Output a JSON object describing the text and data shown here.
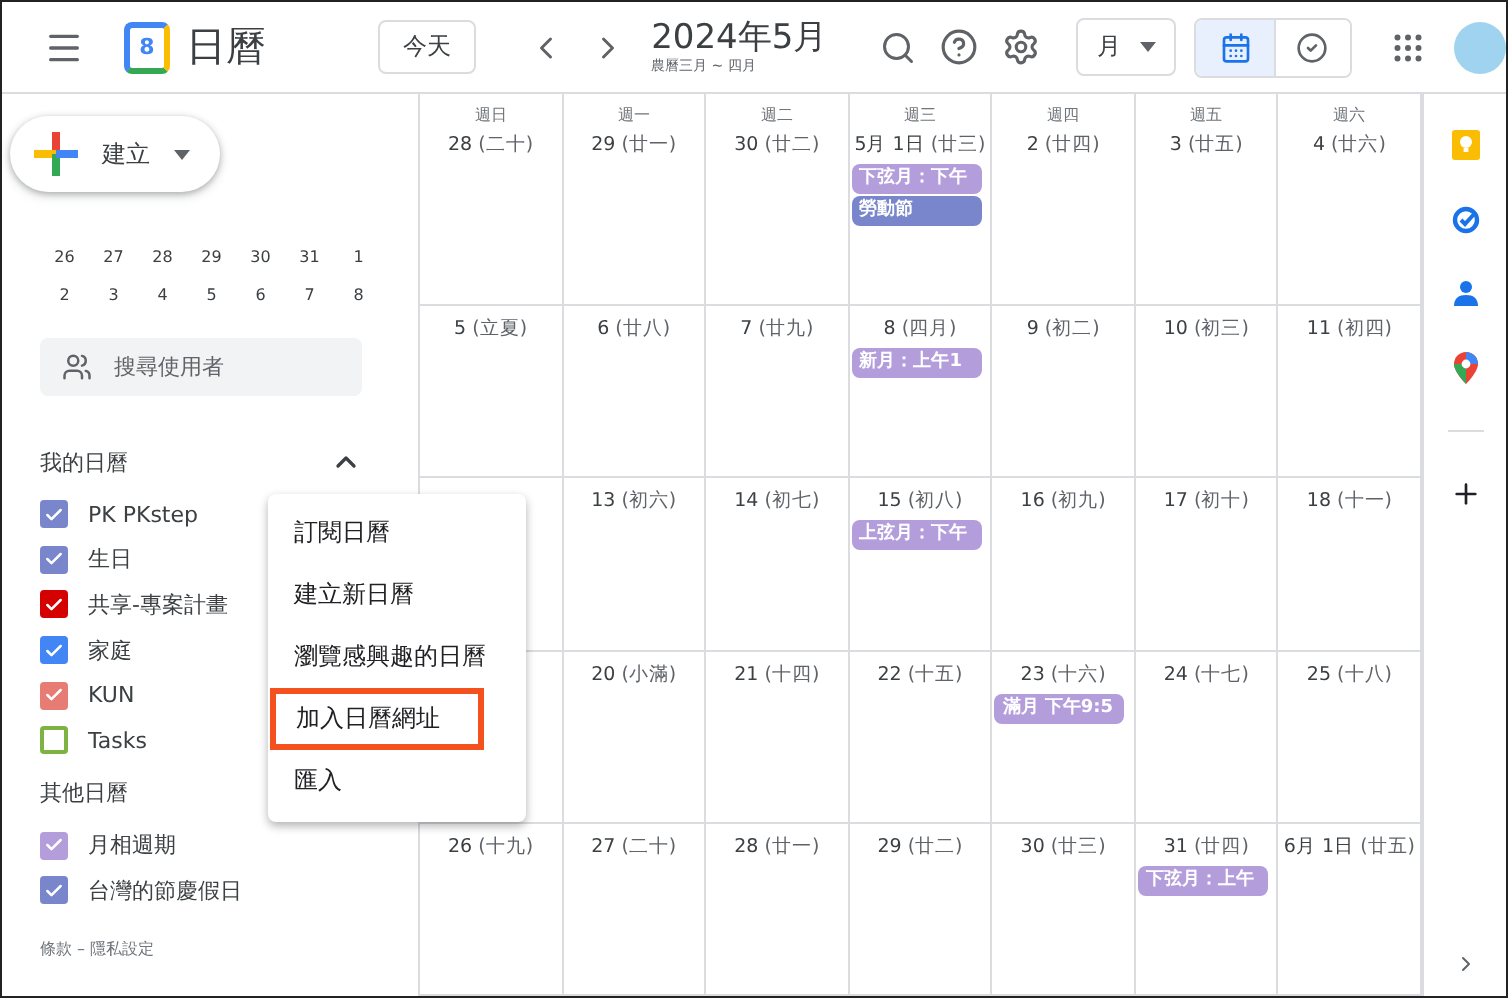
{
  "header": {
    "app_title": "日曆",
    "logo_digit": "8",
    "today_button": "今天",
    "month_title": "2024年5月",
    "lunar_subtitle": "農曆三月 ~ 四月",
    "view_select": "月",
    "view_toggle": [
      {
        "kind": "calendar",
        "selected": true
      },
      {
        "kind": "tasks",
        "selected": false
      }
    ]
  },
  "sidebar": {
    "create_button": "建立",
    "mini_calendar": [
      [
        "26",
        "27",
        "28",
        "29",
        "30",
        "31",
        "1"
      ],
      [
        "2",
        "3",
        "4",
        "5",
        "6",
        "7",
        "8"
      ]
    ],
    "people_search": {
      "placeholder": "搜尋使用者"
    },
    "my_calendars": {
      "title": "我的日曆",
      "expanded": true,
      "items": [
        {
          "label": "PK PKstep",
          "checked": true,
          "color": "#7986cb"
        },
        {
          "label": "生日",
          "checked": true,
          "color": "#7986cb"
        },
        {
          "label": "共享-專案計畫",
          "checked": true,
          "color": "#d50000"
        },
        {
          "label": "家庭",
          "checked": true,
          "color": "#4285f4"
        },
        {
          "label": "KUN",
          "checked": true,
          "color": "#e67c73"
        },
        {
          "label": "Tasks",
          "checked": false,
          "color": "#7cb342"
        }
      ]
    },
    "other_calendars": {
      "title": "其他日曆",
      "items": [
        {
          "label": "月相週期",
          "checked": true,
          "color": "#b39ddb"
        },
        {
          "label": "台灣的節慶假日",
          "checked": true,
          "color": "#7986cb"
        }
      ]
    },
    "footer": "條款 – 隱私設定"
  },
  "calendar": {
    "weekdays": [
      "週日",
      "週一",
      "週二",
      "週三",
      "週四",
      "週五",
      "週六"
    ],
    "weeks": [
      [
        {
          "date": "28",
          "lunar": "(二十)"
        },
        {
          "date": "29",
          "lunar": "(廿一)"
        },
        {
          "date": "30",
          "lunar": "(廿二)"
        },
        {
          "date": "5月 1日",
          "lunar": "(廿三)",
          "events": [
            {
              "title": "下弦月：下午",
              "color": "#b39ddb"
            },
            {
              "title": "勞動節",
              "color": "#7986cb"
            }
          ]
        },
        {
          "date": "2",
          "lunar": "(廿四)"
        },
        {
          "date": "3",
          "lunar": "(廿五)"
        },
        {
          "date": "4",
          "lunar": "(廿六)"
        }
      ],
      [
        {
          "date": "5",
          "lunar": "(立夏)"
        },
        {
          "date": "6",
          "lunar": "(廿八)"
        },
        {
          "date": "7",
          "lunar": "(廿九)"
        },
        {
          "date": "8",
          "lunar": "(四月)",
          "events": [
            {
              "title": "新月：上午1",
              "color": "#b39ddb"
            }
          ]
        },
        {
          "date": "9",
          "lunar": "(初二)"
        },
        {
          "date": "10",
          "lunar": "(初三)"
        },
        {
          "date": "11",
          "lunar": "(初四)"
        }
      ],
      [
        {
          "date": "13",
          "lunar": "(初六)"
        },
        {
          "date": "14",
          "lunar": "(初七)"
        },
        {
          "date": "15",
          "lunar": "(初八)",
          "events": [
            {
              "title": "上弦月：下午",
              "color": "#b39ddb"
            }
          ]
        },
        {
          "date": "16",
          "lunar": "(初九)"
        },
        {
          "date": "17",
          "lunar": "(初十)"
        },
        {
          "date": "18",
          "lunar": "(十一)"
        }
      ],
      [
        {
          "date": "20",
          "lunar": "(小滿)"
        },
        {
          "date": "21",
          "lunar": "(十四)"
        },
        {
          "date": "22",
          "lunar": "(十五)"
        },
        {
          "date": "23",
          "lunar": "(十六)",
          "events": [
            {
              "title": "滿月 下午9:5",
              "color": "#b39ddb"
            }
          ]
        },
        {
          "date": "24",
          "lunar": "(十七)"
        },
        {
          "date": "25",
          "lunar": "(十八)"
        }
      ],
      [
        {
          "date": "26",
          "lunar": "(十九)"
        },
        {
          "date": "27",
          "lunar": "(二十)"
        },
        {
          "date": "28",
          "lunar": "(廿一)"
        },
        {
          "date": "29",
          "lunar": "(廿二)"
        },
        {
          "date": "30",
          "lunar": "(廿三)"
        },
        {
          "date": "31",
          "lunar": "(廿四)",
          "events": [
            {
              "title": "下弦月：上午",
              "color": "#b39ddb"
            }
          ]
        },
        {
          "date": "6月 1日",
          "lunar": "(廿五)"
        }
      ]
    ]
  },
  "context_menu": {
    "items": [
      {
        "label": "訂閱日曆",
        "highlighted": false
      },
      {
        "label": "建立新日曆",
        "highlighted": false
      },
      {
        "label": "瀏覽感興趣的日曆",
        "highlighted": false
      },
      {
        "label": "加入日曆網址",
        "highlighted": true
      },
      {
        "label": "匯入",
        "highlighted": false
      }
    ]
  }
}
